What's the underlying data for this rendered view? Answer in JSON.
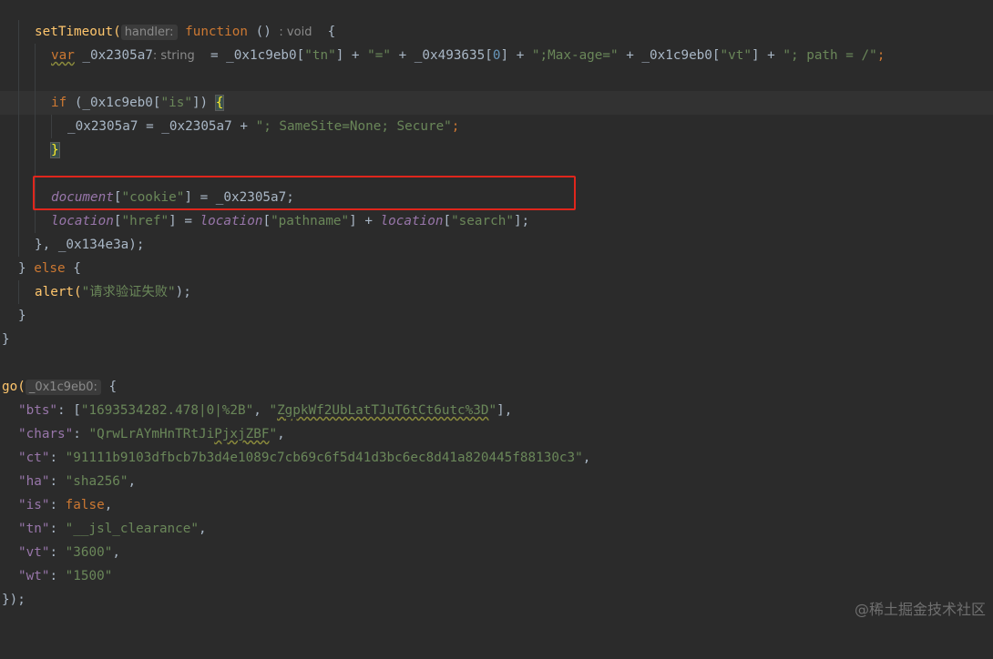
{
  "editor": {
    "lines": {
      "l1": {
        "setTimeout": "setTimeout(",
        "hint_handler": "handler:",
        "function": "function",
        "paren": " () ",
        "hint_void": ": void",
        "brace": "  {"
      },
      "l2": {
        "var": "var",
        "name": " _0x2305a7",
        "hint_type": ": string",
        "expr_a": "  = _0x1c9eb0[",
        "tn": "\"tn\"",
        "expr_b": "] + ",
        "eq": "\"=\"",
        "expr_c": " + _0x493635[",
        "zero": "0",
        "expr_d": "] + ",
        "maxage": "\";Max-age=\"",
        "expr_e": " + _0x1c9eb0[",
        "vt": "\"vt\"",
        "expr_f": "] + ",
        "path": "\"; path = /\"",
        "semi": ";"
      },
      "l4": {
        "if": "if",
        "a": " (_0x1c9eb0[",
        "is": "\"is\"",
        "b": "]) ",
        "brace": "{"
      },
      "l5": {
        "a": "_0x2305a7 = _0x2305a7 + ",
        "samesite": "\"; SameSite=None; Secure\"",
        "semi": ";"
      },
      "l6": {
        "brace": "}"
      },
      "l8": {
        "document": "document",
        "a": "[",
        "cookie": "\"cookie\"",
        "b": "] = _0x2305a7;"
      },
      "l9": {
        "loc1": "location",
        "a": "[",
        "href": "\"href\"",
        "b": "] = ",
        "loc2": "location",
        "c": "[",
        "pathname": "\"pathname\"",
        "d": "] + ",
        "loc3": "location",
        "e": "[",
        "search": "\"search\"",
        "f": "];"
      },
      "l10": {
        "text": "}, _0x134e3a);"
      },
      "l11": {
        "a": "} ",
        "else": "else",
        "b": " {"
      },
      "l12": {
        "alert": "alert(",
        "msg": "\"请求验证失败\"",
        "end": ");"
      },
      "l13": {
        "text": "}"
      },
      "l14": {
        "text": "}"
      },
      "l16": {
        "go": "go(",
        "hint": "_0x1c9eb0:",
        "brace": " {"
      },
      "l17": {
        "key": "\"bts\"",
        "a": ": [",
        "v1": "\"1693534282.478|0|%2B\"",
        "b": ", ",
        "v2a": "\"",
        "v2b": "ZgpkWf2UbLatTJuT6tCt6utc%3D",
        "v2c": "\"",
        "c": "],"
      },
      "l18": {
        "key": "\"chars\"",
        "a": ": ",
        "v1": "\"QrwLrAYmHnTRtJi",
        "v2": "PjxjZBF",
        "v3": "\"",
        "b": ","
      },
      "l19": {
        "key": "\"ct\"",
        "a": ": ",
        "v": "\"91111b9103dfbcb7b3d4e1089c7cb69c6f5d41d3bc6ec8d41a820445f88130c3\"",
        "b": ","
      },
      "l20": {
        "key": "\"ha\"",
        "a": ": ",
        "v": "\"sha256\"",
        "b": ","
      },
      "l21": {
        "key": "\"is\"",
        "a": ": ",
        "v": "false",
        "b": ","
      },
      "l22": {
        "key": "\"tn\"",
        "a": ": ",
        "v": "\"__jsl_clearance\"",
        "b": ","
      },
      "l23": {
        "key": "\"vt\"",
        "a": ": ",
        "v": "\"3600\"",
        "b": ","
      },
      "l24": {
        "key": "\"wt\"",
        "a": ": ",
        "v": "\"1500\""
      },
      "l25": {
        "text": "});"
      }
    }
  },
  "watermark": "@稀土掘金技术社区",
  "colors": {
    "highlight_box": "#e0261c",
    "background": "#2b2b2b",
    "keyword": "#cc7832",
    "string": "#6a8759",
    "function": "#ffc66d",
    "global": "#9876aa"
  }
}
